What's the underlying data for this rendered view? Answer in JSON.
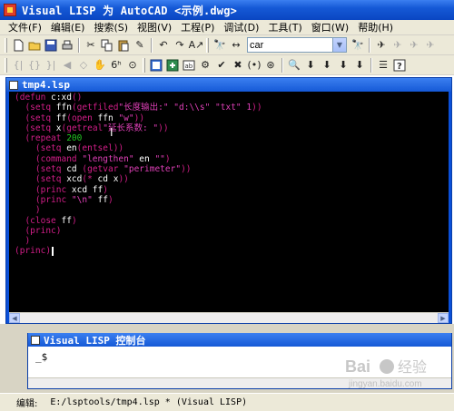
{
  "window": {
    "title": "Visual LISP 为 AutoCAD <示例.dwg>"
  },
  "menu": {
    "items": [
      "文件(F)",
      "编辑(E)",
      "搜索(S)",
      "视图(V)",
      "工程(P)",
      "调试(D)",
      "工具(T)",
      "窗口(W)",
      "帮助(H)"
    ]
  },
  "search": {
    "value": "car"
  },
  "editor": {
    "title": "tmp4.lsp",
    "lines": [
      [
        [
          "p",
          "(defun "
        ],
        [
          "w",
          "c:xd"
        ],
        [
          "p",
          "()"
        ]
      ],
      [
        [
          "p",
          "  (setq "
        ],
        [
          "w",
          "ffn"
        ],
        [
          "p",
          "(getfiled"
        ],
        [
          "s",
          "\"长度输出:\" \"d:\\\\s\" \"txt\" 1"
        ],
        [
          "p",
          "))"
        ]
      ],
      [
        [
          "p",
          "  (setq "
        ],
        [
          "w",
          "ff"
        ],
        [
          "p",
          "(open "
        ],
        [
          "w",
          "ffn "
        ],
        [
          "s",
          "\"w\""
        ],
        [
          "p",
          "))"
        ]
      ],
      [
        [
          "p",
          "  (setq "
        ],
        [
          "w",
          "x"
        ],
        [
          "p",
          "(getreal"
        ],
        [
          "s",
          "\"延长系数: \""
        ],
        [
          "p",
          "))"
        ]
      ],
      [
        [
          "p",
          "  (repeat "
        ],
        [
          "n",
          "200"
        ]
      ],
      [
        [
          "p",
          "    (setq "
        ],
        [
          "w",
          "en"
        ],
        [
          "p",
          "(entsel))"
        ]
      ],
      [
        [
          "p",
          "    (command "
        ],
        [
          "s",
          "\"lengthen\""
        ],
        [
          "w",
          " en "
        ],
        [
          "s",
          "\"\""
        ],
        [
          "p",
          ")"
        ]
      ],
      [
        [
          "p",
          "    (setq "
        ],
        [
          "w",
          "cd "
        ],
        [
          "p",
          "(getvar "
        ],
        [
          "s",
          "\"perimeter\""
        ],
        [
          "p",
          "))"
        ]
      ],
      [
        [
          "p",
          "    (setq "
        ],
        [
          "w",
          "xcd"
        ],
        [
          "p",
          "(* "
        ],
        [
          "w",
          "cd x"
        ],
        [
          "p",
          "))"
        ]
      ],
      [
        [
          "p",
          "    (princ "
        ],
        [
          "w",
          "xcd ff"
        ],
        [
          "p",
          ")"
        ]
      ],
      [
        [
          "p",
          "    (princ "
        ],
        [
          "s",
          "\"\\n\""
        ],
        [
          "w",
          " ff"
        ],
        [
          "p",
          ")"
        ]
      ],
      [
        [
          "p",
          "    )"
        ]
      ],
      [
        [
          "p",
          "  (close "
        ],
        [
          "w",
          "ff"
        ],
        [
          "p",
          ")"
        ]
      ],
      [
        [
          "p",
          "  (princ)"
        ]
      ],
      [
        [
          "p",
          "  )"
        ]
      ],
      [
        [
          "p",
          "(princ)"
        ],
        [
          "c",
          ""
        ]
      ]
    ]
  },
  "console": {
    "title": "Visual LISP 控制台",
    "prompt": "_$"
  },
  "status": {
    "mode": "编辑:",
    "file": "E:/lsptools/tmp4.lsp *  (Visual LISP)"
  },
  "watermark": {
    "text": "Bai 经验",
    "url": "jingyan.baidu.com"
  },
  "colors": {
    "paren": "#d21e88",
    "string": "#e040b8",
    "number": "#22c722",
    "symbol": "#ffffff",
    "background": "#000000"
  }
}
